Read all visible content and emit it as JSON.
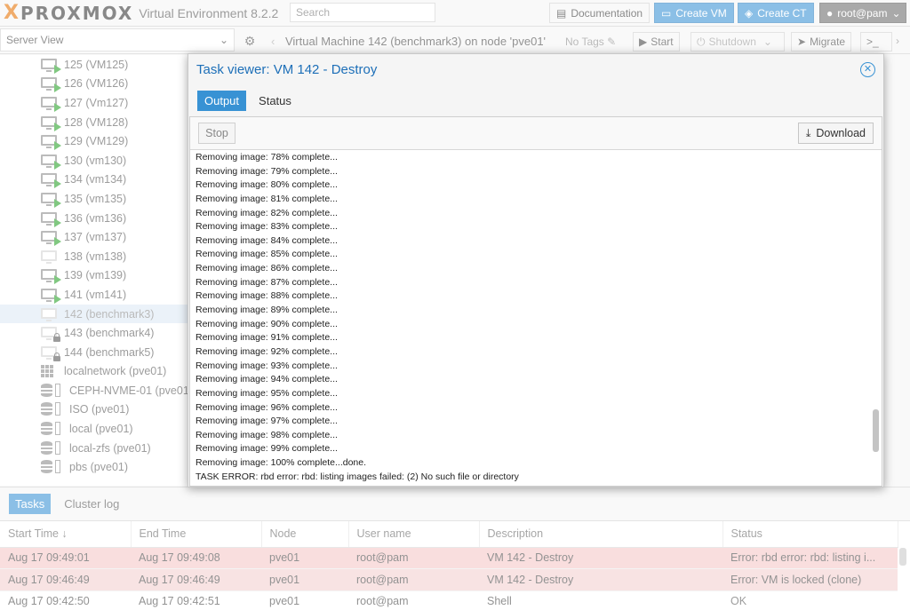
{
  "header": {
    "logo_x": "X",
    "logo_brand": "PROXMOX",
    "logo_sub": "Virtual Environment 8.2.2",
    "search_placeholder": "Search",
    "docs_label": "Documentation",
    "create_vm_label": "Create VM",
    "create_ct_label": "Create CT",
    "user_label": "root@pam"
  },
  "viewbar": {
    "view_label": "Server View",
    "breadcrumb": "Virtual Machine 142 (benchmark3) on node 'pve01'",
    "notags_label": "No Tags",
    "start_label": "Start",
    "shutdown_label": "Shutdown",
    "migrate_label": "Migrate",
    "console_label": ">_"
  },
  "tree": {
    "items": [
      {
        "label": "125 (VM125)",
        "kind": "vm-running"
      },
      {
        "label": "126 (VM126)",
        "kind": "vm-running"
      },
      {
        "label": "127 (Vm127)",
        "kind": "vm-running"
      },
      {
        "label": "128 (VM128)",
        "kind": "vm-running"
      },
      {
        "label": "129 (VM129)",
        "kind": "vm-running"
      },
      {
        "label": "130 (vm130)",
        "kind": "vm-running"
      },
      {
        "label": "134 (vm134)",
        "kind": "vm-running"
      },
      {
        "label": "135 (vm135)",
        "kind": "vm-running"
      },
      {
        "label": "136 (vm136)",
        "kind": "vm-running"
      },
      {
        "label": "137 (vm137)",
        "kind": "vm-running"
      },
      {
        "label": "138 (vm138)",
        "kind": "vm-stopped"
      },
      {
        "label": "139 (vm139)",
        "kind": "vm-running"
      },
      {
        "label": "141 (vm141)",
        "kind": "vm-running"
      },
      {
        "label": "142 (benchmark3)",
        "kind": "vm-selected"
      },
      {
        "label": "143 (benchmark4)",
        "kind": "vm-locked"
      },
      {
        "label": "144 (benchmark5)",
        "kind": "vm-locked"
      },
      {
        "label": "localnetwork (pve01)",
        "kind": "network"
      },
      {
        "label": "CEPH-NVME-01 (pve01)",
        "kind": "storage"
      },
      {
        "label": "ISO (pve01)",
        "kind": "storage"
      },
      {
        "label": "local (pve01)",
        "kind": "storage"
      },
      {
        "label": "local-zfs (pve01)",
        "kind": "storage"
      },
      {
        "label": "pbs (pve01)",
        "kind": "storage"
      }
    ]
  },
  "modal": {
    "title": "Task viewer: VM 142 - Destroy",
    "close_glyph": "✕",
    "tab_output": "Output",
    "tab_status": "Status",
    "stop_label": "Stop",
    "download_label": "Download",
    "log_lines": [
      "Removing image: 78% complete...",
      "Removing image: 79% complete...",
      "Removing image: 80% complete...",
      "Removing image: 81% complete...",
      "Removing image: 82% complete...",
      "Removing image: 83% complete...",
      "Removing image: 84% complete...",
      "Removing image: 85% complete...",
      "Removing image: 86% complete...",
      "Removing image: 87% complete...",
      "Removing image: 88% complete...",
      "Removing image: 89% complete...",
      "Removing image: 90% complete...",
      "Removing image: 91% complete...",
      "Removing image: 92% complete...",
      "Removing image: 93% complete...",
      "Removing image: 94% complete...",
      "Removing image: 95% complete...",
      "Removing image: 96% complete...",
      "Removing image: 97% complete...",
      "Removing image: 98% complete...",
      "Removing image: 99% complete...",
      "Removing image: 100% complete...done.",
      "TASK ERROR: rbd error: rbd: listing images failed: (2) No such file or directory"
    ]
  },
  "bottom": {
    "tab_tasks": "Tasks",
    "tab_cluster_log": "Cluster log",
    "columns": [
      "Start Time ↓",
      "End Time",
      "Node",
      "User name",
      "Description",
      "Status"
    ],
    "rows": [
      {
        "start": "Aug 17 09:49:01",
        "end": "Aug 17 09:49:08",
        "node": "pve01",
        "user": "root@pam",
        "desc": "VM 142 - Destroy",
        "status": "Error: rbd error: rbd: listing i...",
        "error": true
      },
      {
        "start": "Aug 17 09:46:49",
        "end": "Aug 17 09:46:49",
        "node": "pve01",
        "user": "root@pam",
        "desc": "VM 142 - Destroy",
        "status": "Error: VM is locked (clone)",
        "error": true
      },
      {
        "start": "Aug 17 09:42:50",
        "end": "Aug 17 09:42:51",
        "node": "pve01",
        "user": "root@pam",
        "desc": "Shell",
        "status": "OK",
        "error": false
      }
    ]
  },
  "colors": {
    "accent": "#3892d4",
    "error_row": "#f5c7c7",
    "vm_running": "#27a127",
    "logo_orange": "#e57000"
  }
}
